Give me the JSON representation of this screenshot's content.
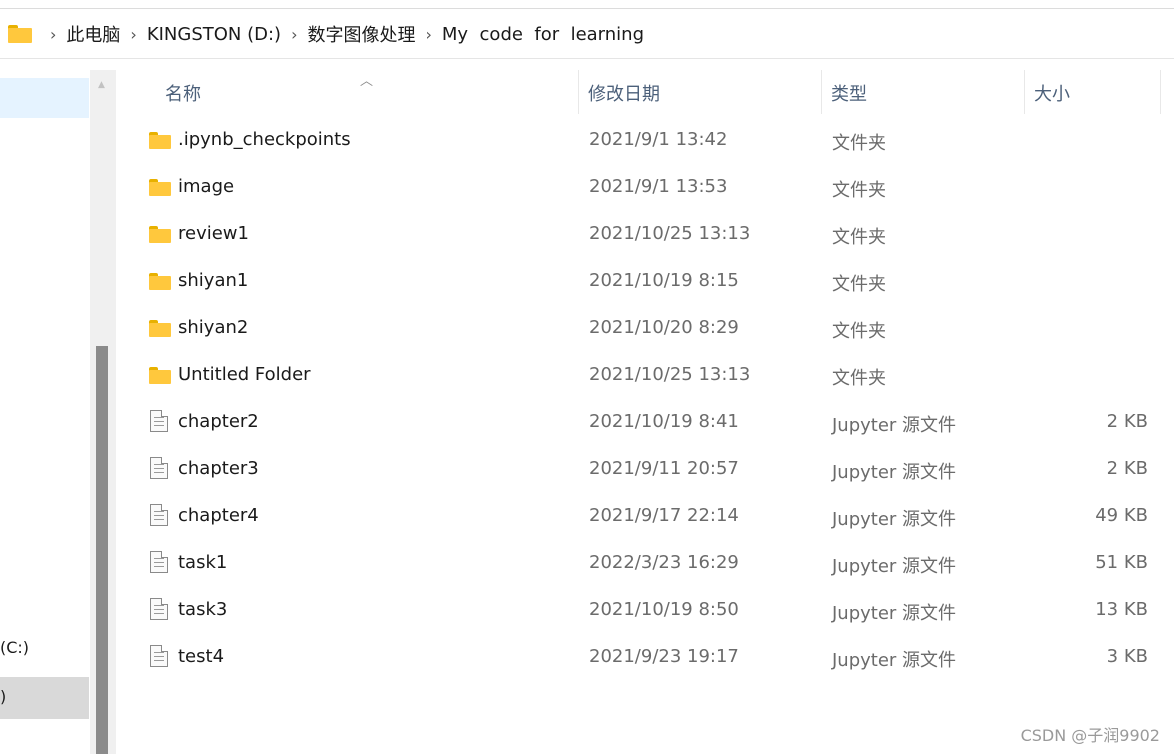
{
  "address": {
    "crumbs": [
      "此电脑",
      "KINGSTON (D:)",
      "数字图像处理",
      "My  code  for  learning"
    ]
  },
  "nav": {
    "drive_label": "(C:)",
    "selected_label": ")"
  },
  "headers": {
    "name": "名称",
    "date": "修改日期",
    "type": "类型",
    "size": "大小"
  },
  "rows": [
    {
      "name": ".ipynb_checkpoints",
      "date": "2021/9/1 13:42",
      "type": "文件夹",
      "size": "",
      "icon": "folder-icon"
    },
    {
      "name": "image",
      "date": "2021/9/1 13:53",
      "type": "文件夹",
      "size": "",
      "icon": "folder-icon"
    },
    {
      "name": "review1",
      "date": "2021/10/25 13:13",
      "type": "文件夹",
      "size": "",
      "icon": "folder-icon"
    },
    {
      "name": "shiyan1",
      "date": "2021/10/19 8:15",
      "type": "文件夹",
      "size": "",
      "icon": "folder-icon"
    },
    {
      "name": "shiyan2",
      "date": "2021/10/20 8:29",
      "type": "文件夹",
      "size": "",
      "icon": "folder-icon"
    },
    {
      "name": "Untitled Folder",
      "date": "2021/10/25 13:13",
      "type": "文件夹",
      "size": "",
      "icon": "folder-icon"
    },
    {
      "name": "chapter2",
      "date": "2021/10/19 8:41",
      "type": "Jupyter 源文件",
      "size": "2 KB",
      "icon": "file-icon"
    },
    {
      "name": "chapter3",
      "date": "2021/9/11 20:57",
      "type": "Jupyter 源文件",
      "size": "2 KB",
      "icon": "file-icon"
    },
    {
      "name": "chapter4",
      "date": "2021/9/17 22:14",
      "type": "Jupyter 源文件",
      "size": "49 KB",
      "icon": "file-icon"
    },
    {
      "name": "task1",
      "date": "2022/3/23 16:29",
      "type": "Jupyter 源文件",
      "size": "51 KB",
      "icon": "file-icon"
    },
    {
      "name": "task3",
      "date": "2021/10/19 8:50",
      "type": "Jupyter 源文件",
      "size": "13 KB",
      "icon": "file-icon"
    },
    {
      "name": "test4",
      "date": "2021/9/23 19:17",
      "type": "Jupyter 源文件",
      "size": "3 KB",
      "icon": "file-icon"
    }
  ],
  "watermark": "CSDN @子润9902"
}
